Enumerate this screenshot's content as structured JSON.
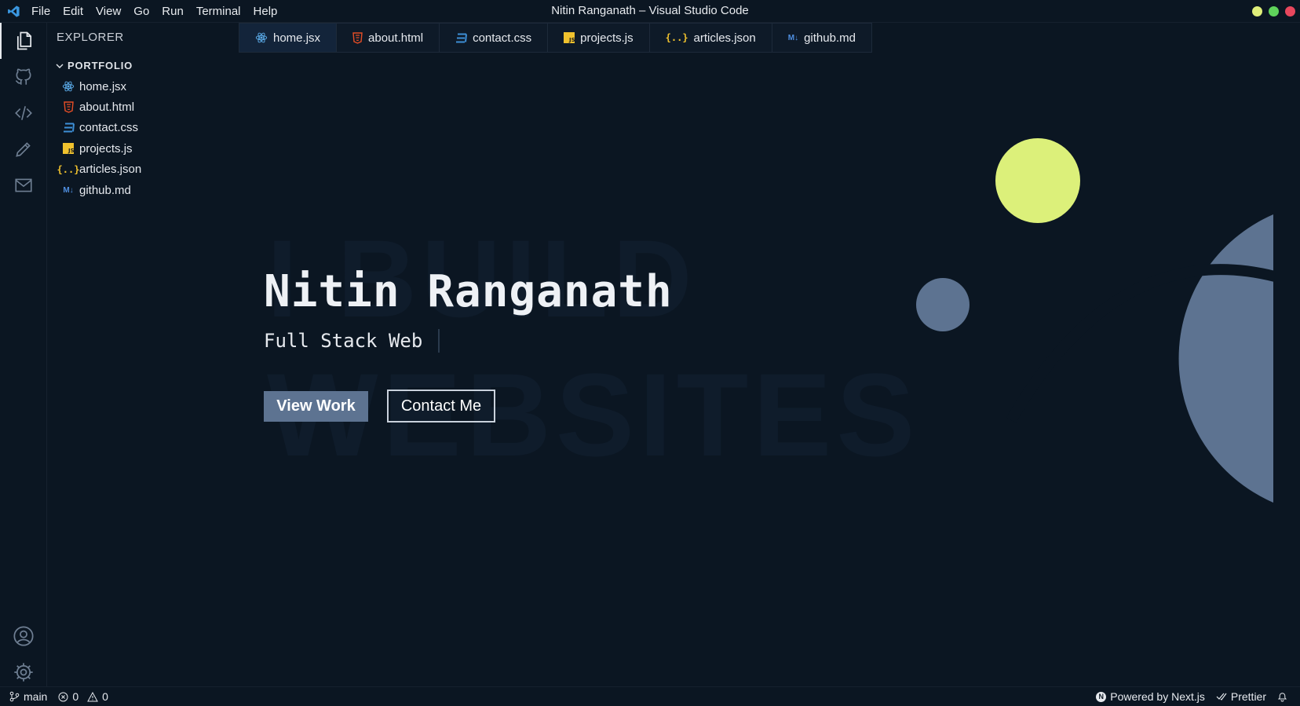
{
  "window": {
    "title": "Nitin Ranganath – Visual Studio Code",
    "menu": [
      "File",
      "Edit",
      "View",
      "Go",
      "Run",
      "Terminal",
      "Help"
    ],
    "traffic_colors": [
      "#dfee7a",
      "#5fd35b",
      "#e8475d"
    ]
  },
  "activity": {
    "icons": [
      "files-icon",
      "github-icon",
      "code-icon",
      "pencil-icon",
      "mail-icon",
      "account-icon",
      "settings-gear-icon"
    ]
  },
  "explorer": {
    "title": "EXPLORER",
    "folder": "PORTFOLIO",
    "files": [
      {
        "name": "home.jsx",
        "icon": "react-icon",
        "color": "#5aa9e6"
      },
      {
        "name": "about.html",
        "icon": "html-icon",
        "color": "#e44d26"
      },
      {
        "name": "contact.css",
        "icon": "css-icon",
        "color": "#3d8fd6"
      },
      {
        "name": "projects.js",
        "icon": "javascript-icon",
        "color": "#f0c22e"
      },
      {
        "name": "articles.json",
        "icon": "json-icon",
        "color": "#f0c22e"
      },
      {
        "name": "github.md",
        "icon": "markdown-icon",
        "color": "#4f8fe0"
      }
    ]
  },
  "tabs": [
    {
      "label": "home.jsx",
      "active": true
    },
    {
      "label": "about.html",
      "active": false
    },
    {
      "label": "contact.css",
      "active": false
    },
    {
      "label": "projects.js",
      "active": false
    },
    {
      "label": "articles.json",
      "active": false
    },
    {
      "label": "github.md",
      "active": false
    }
  ],
  "hero": {
    "name": "Nitin Ranganath",
    "subtitle": "Full Stack Web",
    "bg_text_line1": "I BUILD",
    "bg_text_line2": "WEBSITES",
    "primary_button": "View Work",
    "secondary_button": "Contact Me",
    "accent_color": "#dcf07a",
    "shape_color": "#5d7391"
  },
  "status": {
    "branch": "main",
    "errors": "0",
    "warnings": "0",
    "powered": "Powered by Next.js",
    "prettier": "Prettier"
  }
}
